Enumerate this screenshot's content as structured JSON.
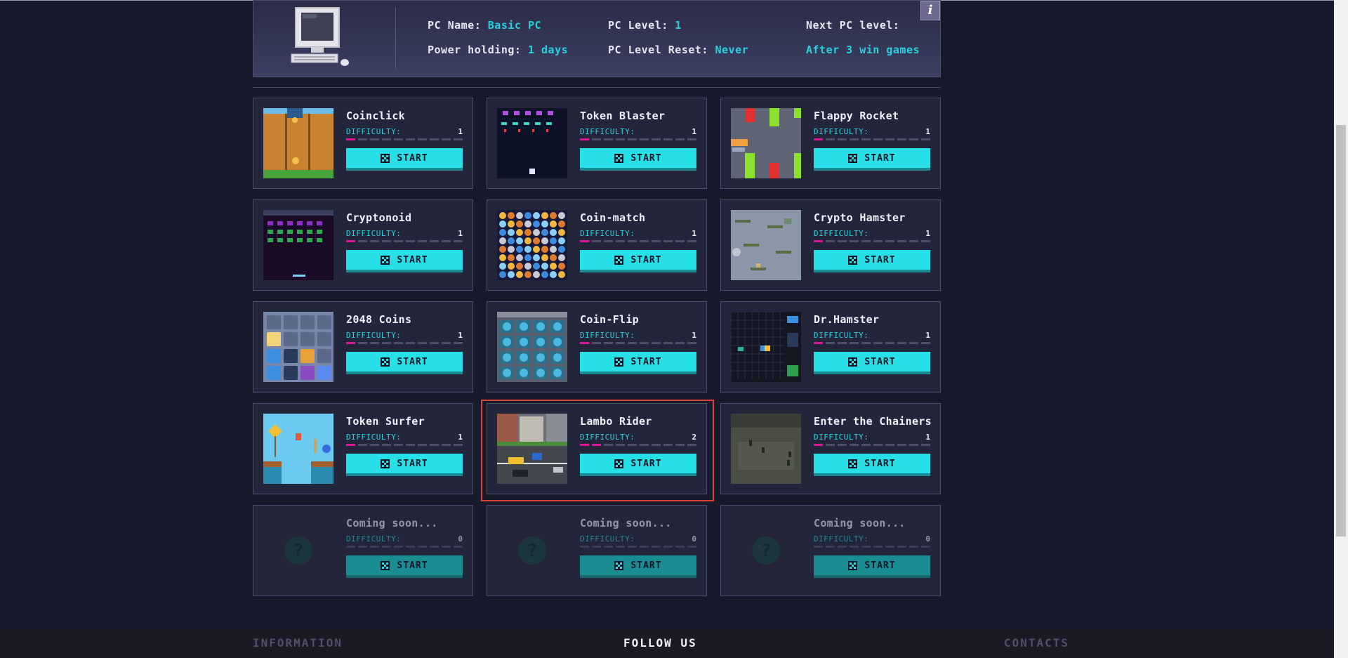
{
  "pc": {
    "name_label": "PC Name:",
    "name_value": "Basic PC",
    "level_label": "PC Level:",
    "level_value": "1",
    "next_level_label": "Next PC level:",
    "next_level_value": "After 3 win games",
    "power_label": "Power holding:",
    "power_value": "1 days",
    "reset_label": "PC Level Reset:",
    "reset_value": "Never",
    "info_button": "i"
  },
  "games": [
    {
      "title": "Coinclick",
      "difficulty_label": "DIFFICULTY:",
      "difficulty": 1,
      "button": "START",
      "thumb": "wood-fence-coin"
    },
    {
      "title": "Token Blaster",
      "difficulty_label": "DIFFICULTY:",
      "difficulty": 1,
      "button": "START",
      "thumb": "space-invaders"
    },
    {
      "title": "Flappy Rocket",
      "difficulty_label": "DIFFICULTY:",
      "difficulty": 1,
      "button": "START",
      "thumb": "pipes-rocket"
    },
    {
      "title": "Cryptonoid",
      "difficulty_label": "DIFFICULTY:",
      "difficulty": 1,
      "button": "START",
      "thumb": "brick-breaker"
    },
    {
      "title": "Coin-match",
      "difficulty_label": "DIFFICULTY:",
      "difficulty": 1,
      "button": "START",
      "thumb": "coin-grid"
    },
    {
      "title": "Crypto Hamster",
      "difficulty_label": "DIFFICULTY:",
      "difficulty": 1,
      "button": "START",
      "thumb": "platforms"
    },
    {
      "title": "2048 Coins",
      "difficulty_label": "DIFFICULTY:",
      "difficulty": 1,
      "button": "START",
      "thumb": "tiles-2048"
    },
    {
      "title": "Coin-Flip",
      "difficulty_label": "DIFFICULTY:",
      "difficulty": 1,
      "button": "START",
      "thumb": "flip-grid"
    },
    {
      "title": "Dr.Hamster",
      "difficulty_label": "DIFFICULTY:",
      "difficulty": 1,
      "button": "START",
      "thumb": "puzzle-grid"
    },
    {
      "title": "Token Surfer",
      "difficulty_label": "DIFFICULTY:",
      "difficulty": 1,
      "button": "START",
      "thumb": "sky-runner"
    },
    {
      "title": "Lambo Rider",
      "difficulty_label": "DIFFICULTY:",
      "difficulty": 2,
      "button": "START",
      "thumb": "city-road"
    },
    {
      "title": "Enter the Chainers",
      "difficulty_label": "DIFFICULTY:",
      "difficulty": 1,
      "button": "START",
      "thumb": "top-down-street"
    },
    {
      "title": "Coming soon...",
      "difficulty_label": "DIFFICULTY:",
      "difficulty": 0,
      "button": "START",
      "thumb": "question-mark"
    },
    {
      "title": "Coming soon...",
      "difficulty_label": "DIFFICULTY:",
      "difficulty": 0,
      "button": "START",
      "thumb": "question-mark"
    },
    {
      "title": "Coming soon...",
      "difficulty_label": "DIFFICULTY:",
      "difficulty": 0,
      "button": "START",
      "thumb": "question-mark"
    }
  ],
  "footer": {
    "information": "INFORMATION",
    "follow": "FOLLOW US",
    "contacts": "CONTACTS"
  },
  "colors": {
    "accent": "#27dfe6",
    "value_text": "#27d1df",
    "difficulty_fill": "#e0149a",
    "highlight": "#e0403c"
  }
}
